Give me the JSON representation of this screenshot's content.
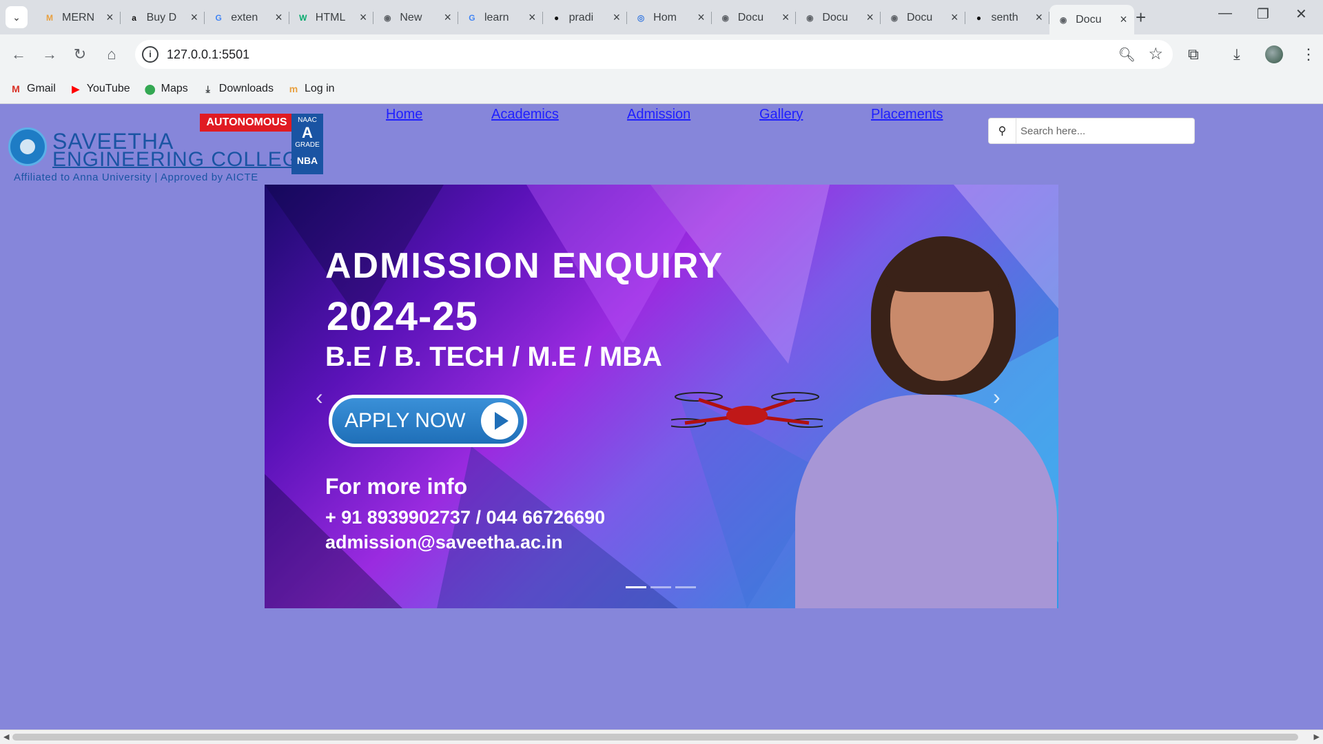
{
  "browser": {
    "tabs": [
      {
        "title": "MERN",
        "favicon": "mern-icon"
      },
      {
        "title": "Buy D",
        "favicon": "amazon-icon"
      },
      {
        "title": "exten",
        "favicon": "google-icon"
      },
      {
        "title": "HTML",
        "favicon": "w3schools-icon"
      },
      {
        "title": "New",
        "favicon": "globe-icon"
      },
      {
        "title": "learn",
        "favicon": "google-icon"
      },
      {
        "title": "pradi",
        "favicon": "github-icon"
      },
      {
        "title": "Hom",
        "favicon": "site-icon"
      },
      {
        "title": "Docu",
        "favicon": "globe-icon"
      },
      {
        "title": "Docu",
        "favicon": "globe-icon"
      },
      {
        "title": "Docu",
        "favicon": "globe-icon"
      },
      {
        "title": "senth",
        "favicon": "github-icon"
      },
      {
        "title": "Docu",
        "favicon": "globe-icon",
        "active": true
      }
    ],
    "url": "127.0.0.1:5501",
    "bookmarks": [
      {
        "label": "Gmail",
        "icon": "gmail-icon"
      },
      {
        "label": "YouTube",
        "icon": "youtube-icon"
      },
      {
        "label": "Maps",
        "icon": "maps-icon"
      },
      {
        "label": "Downloads",
        "icon": "download-icon"
      },
      {
        "label": "Log in",
        "icon": "login-icon"
      }
    ]
  },
  "site": {
    "logo": {
      "name_line1": "SAVEETHA",
      "name_line2": "ENGINEERING COLLEGE",
      "affiliation": "Affiliated to Anna University | Approved by AICTE",
      "badge": "AUTONOMOUS",
      "naac_top": "NAAC",
      "naac_grade": "A",
      "naac_label": "GRADE",
      "nba": "NBA"
    },
    "nav": [
      "Home",
      "Academics",
      "Admission",
      "Gallery",
      "Placements"
    ],
    "search_placeholder": "Search here...",
    "slide": {
      "heading1": "ADMISSION ENQUIRY",
      "heading2": "2024-25",
      "programs": "B.E / B. TECH / M.E / MBA",
      "cta": "APPLY NOW",
      "more_info": "For more info",
      "phones": "+ 91 8939902737 / 044 66726690",
      "email": "admission@saveetha.ac.in"
    },
    "carousel_count": 3,
    "carousel_active": 0
  },
  "colors": {
    "page_bg": "#8686da",
    "link": "#1f1fff",
    "brand_blue": "#1a54a3",
    "badge_red": "#e01b22"
  }
}
